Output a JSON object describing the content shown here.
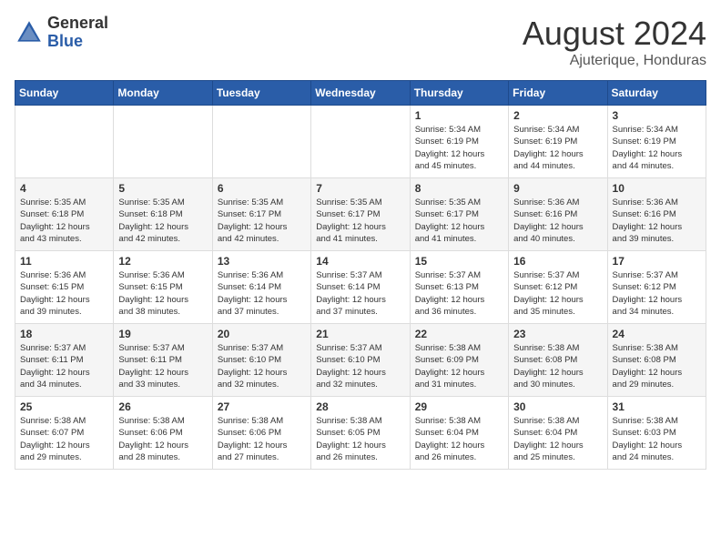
{
  "header": {
    "logo_general": "General",
    "logo_blue": "Blue",
    "month_year": "August 2024",
    "location": "Ajuterique, Honduras"
  },
  "weekdays": [
    "Sunday",
    "Monday",
    "Tuesday",
    "Wednesday",
    "Thursday",
    "Friday",
    "Saturday"
  ],
  "weeks": [
    [
      {
        "day": "",
        "info": ""
      },
      {
        "day": "",
        "info": ""
      },
      {
        "day": "",
        "info": ""
      },
      {
        "day": "",
        "info": ""
      },
      {
        "day": "1",
        "info": "Sunrise: 5:34 AM\nSunset: 6:19 PM\nDaylight: 12 hours\nand 45 minutes."
      },
      {
        "day": "2",
        "info": "Sunrise: 5:34 AM\nSunset: 6:19 PM\nDaylight: 12 hours\nand 44 minutes."
      },
      {
        "day": "3",
        "info": "Sunrise: 5:34 AM\nSunset: 6:19 PM\nDaylight: 12 hours\nand 44 minutes."
      }
    ],
    [
      {
        "day": "4",
        "info": "Sunrise: 5:35 AM\nSunset: 6:18 PM\nDaylight: 12 hours\nand 43 minutes."
      },
      {
        "day": "5",
        "info": "Sunrise: 5:35 AM\nSunset: 6:18 PM\nDaylight: 12 hours\nand 42 minutes."
      },
      {
        "day": "6",
        "info": "Sunrise: 5:35 AM\nSunset: 6:17 PM\nDaylight: 12 hours\nand 42 minutes."
      },
      {
        "day": "7",
        "info": "Sunrise: 5:35 AM\nSunset: 6:17 PM\nDaylight: 12 hours\nand 41 minutes."
      },
      {
        "day": "8",
        "info": "Sunrise: 5:35 AM\nSunset: 6:17 PM\nDaylight: 12 hours\nand 41 minutes."
      },
      {
        "day": "9",
        "info": "Sunrise: 5:36 AM\nSunset: 6:16 PM\nDaylight: 12 hours\nand 40 minutes."
      },
      {
        "day": "10",
        "info": "Sunrise: 5:36 AM\nSunset: 6:16 PM\nDaylight: 12 hours\nand 39 minutes."
      }
    ],
    [
      {
        "day": "11",
        "info": "Sunrise: 5:36 AM\nSunset: 6:15 PM\nDaylight: 12 hours\nand 39 minutes."
      },
      {
        "day": "12",
        "info": "Sunrise: 5:36 AM\nSunset: 6:15 PM\nDaylight: 12 hours\nand 38 minutes."
      },
      {
        "day": "13",
        "info": "Sunrise: 5:36 AM\nSunset: 6:14 PM\nDaylight: 12 hours\nand 37 minutes."
      },
      {
        "day": "14",
        "info": "Sunrise: 5:37 AM\nSunset: 6:14 PM\nDaylight: 12 hours\nand 37 minutes."
      },
      {
        "day": "15",
        "info": "Sunrise: 5:37 AM\nSunset: 6:13 PM\nDaylight: 12 hours\nand 36 minutes."
      },
      {
        "day": "16",
        "info": "Sunrise: 5:37 AM\nSunset: 6:12 PM\nDaylight: 12 hours\nand 35 minutes."
      },
      {
        "day": "17",
        "info": "Sunrise: 5:37 AM\nSunset: 6:12 PM\nDaylight: 12 hours\nand 34 minutes."
      }
    ],
    [
      {
        "day": "18",
        "info": "Sunrise: 5:37 AM\nSunset: 6:11 PM\nDaylight: 12 hours\nand 34 minutes."
      },
      {
        "day": "19",
        "info": "Sunrise: 5:37 AM\nSunset: 6:11 PM\nDaylight: 12 hours\nand 33 minutes."
      },
      {
        "day": "20",
        "info": "Sunrise: 5:37 AM\nSunset: 6:10 PM\nDaylight: 12 hours\nand 32 minutes."
      },
      {
        "day": "21",
        "info": "Sunrise: 5:37 AM\nSunset: 6:10 PM\nDaylight: 12 hours\nand 32 minutes."
      },
      {
        "day": "22",
        "info": "Sunrise: 5:38 AM\nSunset: 6:09 PM\nDaylight: 12 hours\nand 31 minutes."
      },
      {
        "day": "23",
        "info": "Sunrise: 5:38 AM\nSunset: 6:08 PM\nDaylight: 12 hours\nand 30 minutes."
      },
      {
        "day": "24",
        "info": "Sunrise: 5:38 AM\nSunset: 6:08 PM\nDaylight: 12 hours\nand 29 minutes."
      }
    ],
    [
      {
        "day": "25",
        "info": "Sunrise: 5:38 AM\nSunset: 6:07 PM\nDaylight: 12 hours\nand 29 minutes."
      },
      {
        "day": "26",
        "info": "Sunrise: 5:38 AM\nSunset: 6:06 PM\nDaylight: 12 hours\nand 28 minutes."
      },
      {
        "day": "27",
        "info": "Sunrise: 5:38 AM\nSunset: 6:06 PM\nDaylight: 12 hours\nand 27 minutes."
      },
      {
        "day": "28",
        "info": "Sunrise: 5:38 AM\nSunset: 6:05 PM\nDaylight: 12 hours\nand 26 minutes."
      },
      {
        "day": "29",
        "info": "Sunrise: 5:38 AM\nSunset: 6:04 PM\nDaylight: 12 hours\nand 26 minutes."
      },
      {
        "day": "30",
        "info": "Sunrise: 5:38 AM\nSunset: 6:04 PM\nDaylight: 12 hours\nand 25 minutes."
      },
      {
        "day": "31",
        "info": "Sunrise: 5:38 AM\nSunset: 6:03 PM\nDaylight: 12 hours\nand 24 minutes."
      }
    ]
  ]
}
